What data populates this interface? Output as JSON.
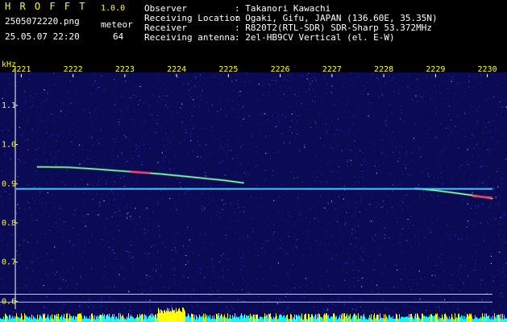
{
  "app": {
    "name": "H R O F F T",
    "version": "1.0.0",
    "filename": "2505072220.png",
    "datetime": "25.05.07 22:20",
    "meteor_label": "meteor",
    "meteor_count": "64"
  },
  "info": {
    "rows": [
      {
        "label": "Observer",
        "value": ": Takanori Kawachi"
      },
      {
        "label": "Receiving Location",
        "value": ": Ogaki, Gifu, JAPAN (136.60E, 35.35N)"
      },
      {
        "label": "Receiver",
        "value": ": R820T2(RTL-SDR) SDR-Sharp 53.372MHz"
      },
      {
        "label": "Receiving antenna",
        "value": ": 2el-HB9CV Vertical (el. E-W)"
      }
    ]
  },
  "colors": {
    "header_text": "#ffff00",
    "info_text": "#00e5ff",
    "background": "#000000",
    "noise_base": "#0a0a55",
    "carrier_line": "#40c8ff",
    "ref_lines": "#b8c4ff"
  },
  "chart_data": {
    "type": "heatmap",
    "ylabel": "kHz",
    "x_ticks": [
      "2221",
      "2222",
      "2223",
      "2224",
      "2225",
      "2226",
      "2227",
      "2228",
      "2229",
      "2230"
    ],
    "y_ticks": [
      "1.1",
      "1.0",
      "0.9",
      "0.8",
      "0.7",
      "0.6"
    ],
    "ylim": [
      0.58,
      1.18
    ],
    "xlim": [
      2220.9,
      2230.1
    ],
    "carrier_khz": 0.887,
    "reference_lines_khz": [
      0.618,
      0.598
    ],
    "meteor_traces": [
      {
        "x": [
          2221.3,
          2221.9,
          2222.5,
          2223.1,
          2223.7,
          2224.3,
          2224.9,
          2225.3
        ],
        "y": [
          0.943,
          0.942,
          0.937,
          0.931,
          0.925,
          0.917,
          0.909,
          0.902
        ],
        "peak_at": 2223.3
      },
      {
        "x": [
          2228.6,
          2229.0,
          2229.4,
          2229.8,
          2230.1
        ],
        "y": [
          0.888,
          0.883,
          0.876,
          0.869,
          0.862
        ],
        "peak_at": 2229.9
      }
    ]
  }
}
